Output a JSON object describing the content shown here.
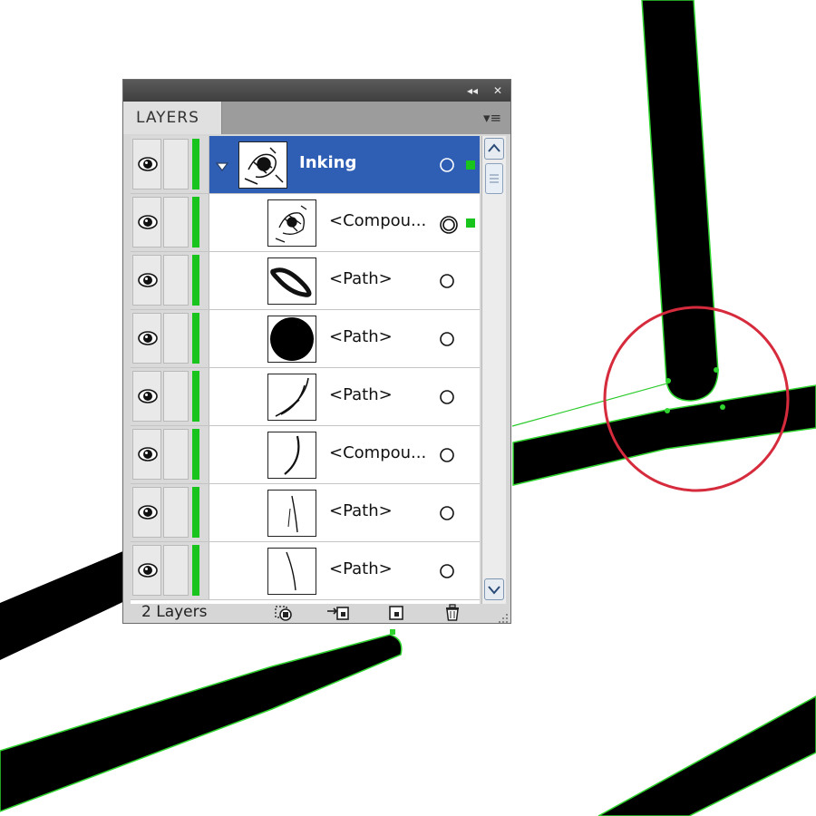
{
  "panel": {
    "tab_label": "LAYERS",
    "collapse_glyph": "◂◂",
    "close_glyph": "✕",
    "menu_glyph": "▾≡",
    "footer_label": "2 Layers"
  },
  "rows": [
    {
      "name": "Inking",
      "level": 0,
      "selected": true,
      "expanded": true,
      "thumb": "inking",
      "target": "open",
      "selection_square": true
    },
    {
      "name": "<Compou...",
      "level": 1,
      "selected": false,
      "thumb": "compound-1",
      "target": "double",
      "selection_square": true
    },
    {
      "name": "<Path>",
      "level": 1,
      "selected": false,
      "thumb": "loop",
      "target": "open",
      "selection_square": false
    },
    {
      "name": "<Path>",
      "level": 1,
      "selected": false,
      "thumb": "disc",
      "target": "open",
      "selection_square": false
    },
    {
      "name": "<Path>",
      "level": 1,
      "selected": false,
      "thumb": "strokes",
      "target": "open",
      "selection_square": false
    },
    {
      "name": "<Compou...",
      "level": 1,
      "selected": false,
      "thumb": "curve",
      "target": "open",
      "selection_square": false
    },
    {
      "name": "<Path>",
      "level": 1,
      "selected": false,
      "thumb": "thin-curve",
      "target": "open",
      "selection_square": false
    },
    {
      "name": "<Path>",
      "level": 1,
      "selected": false,
      "thumb": "thin-line",
      "target": "open",
      "selection_square": false
    }
  ],
  "footer_buttons": [
    "make-clipping-mask-icon",
    "create-sublayer-icon",
    "new-layer-icon",
    "trash-icon"
  ],
  "colors": {
    "layer_color": "#19c51d",
    "selection_blue": "#2f5fb5",
    "highlight_circle": "#d62b3c",
    "path_outline": "#31e03a"
  }
}
